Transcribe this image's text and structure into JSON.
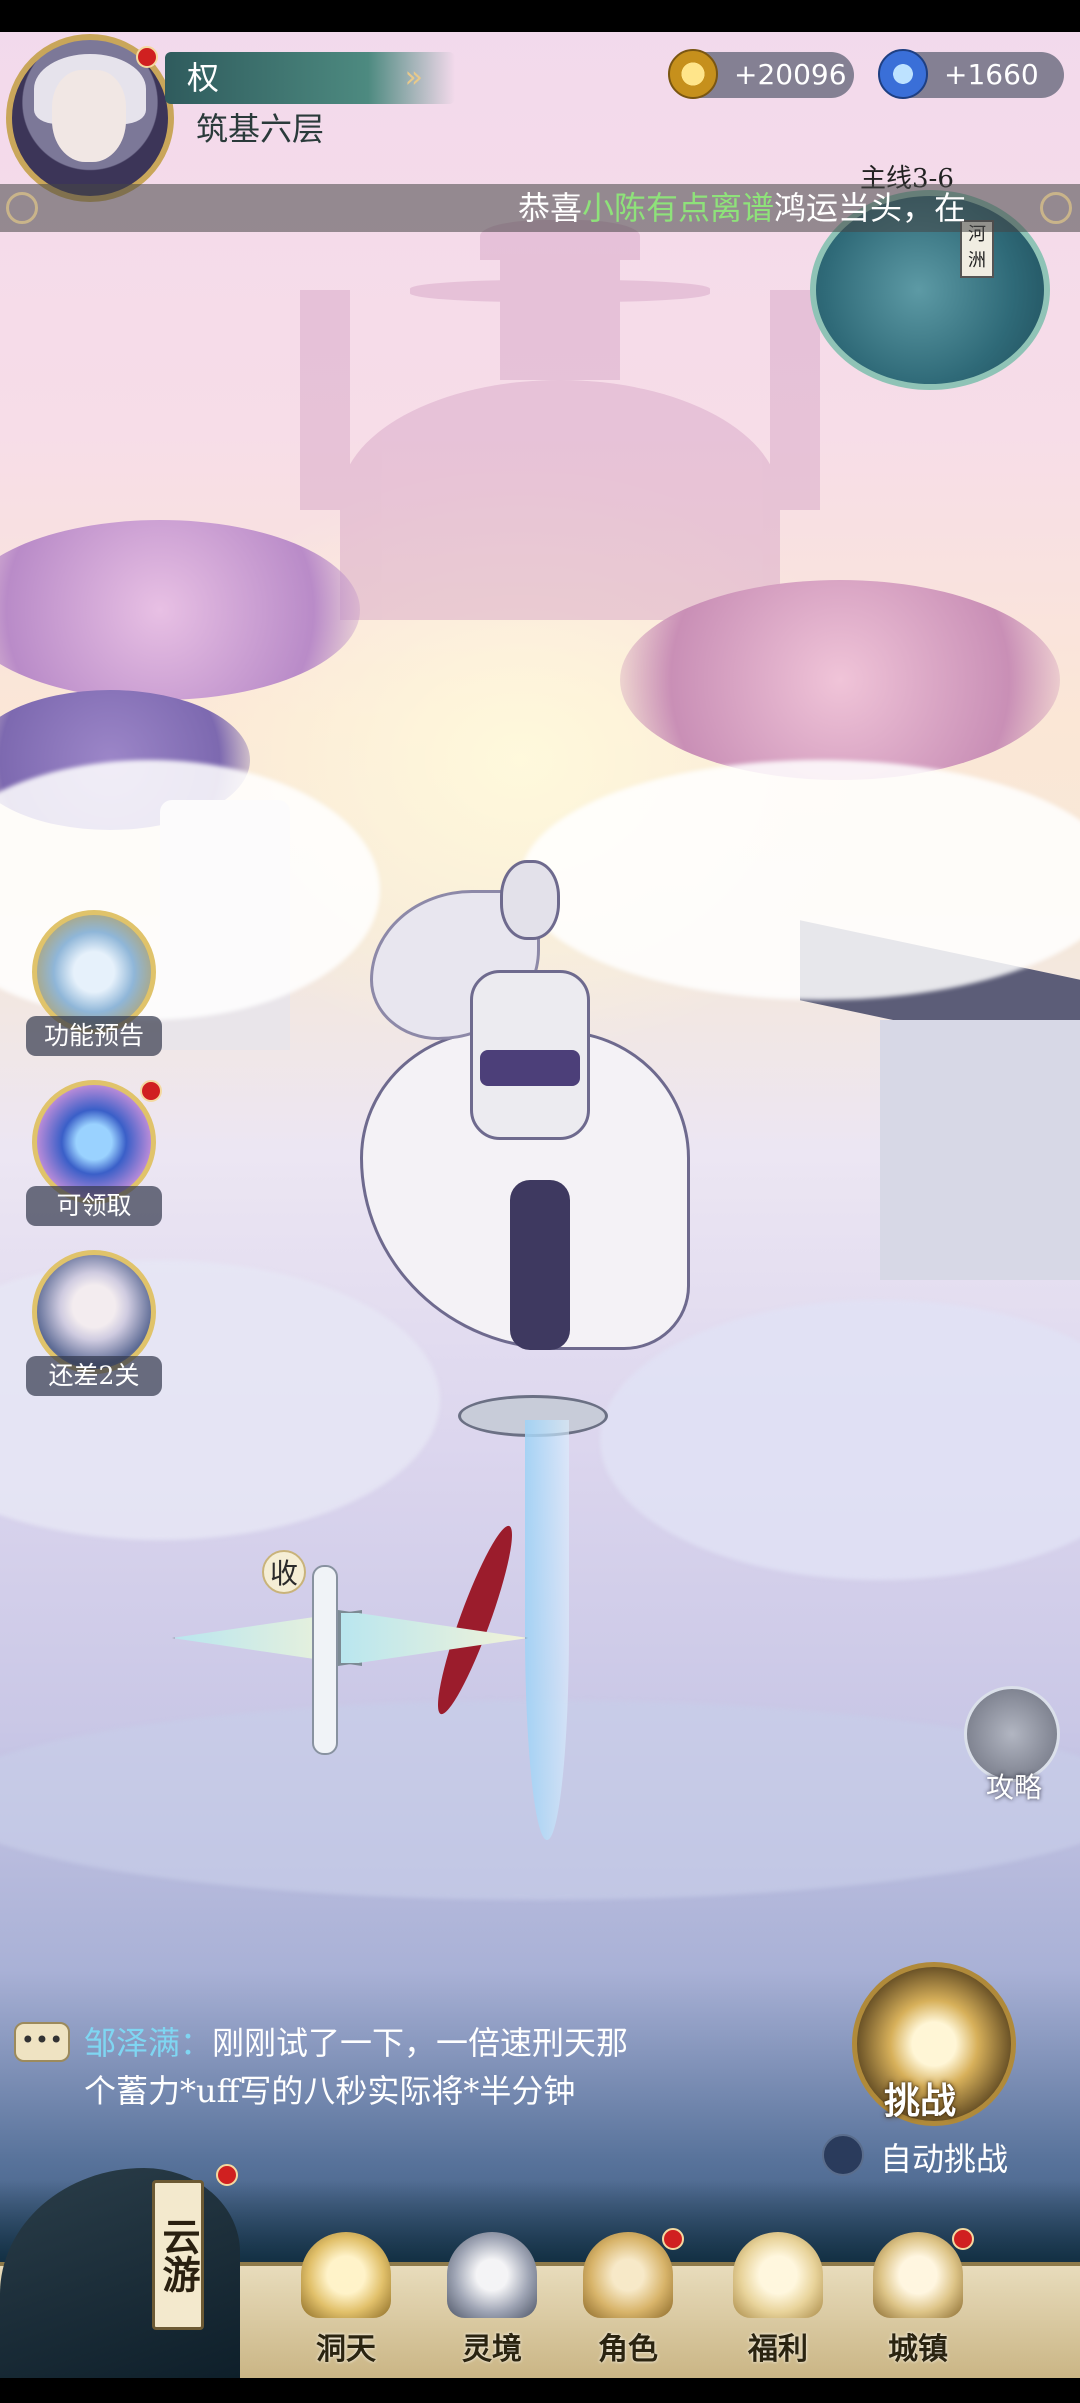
{
  "player": {
    "name": "权",
    "realm": "筑基六层"
  },
  "currency": {
    "coins": "20096",
    "gems": "1660"
  },
  "marquee": {
    "prefix": "恭喜",
    "player": "小陈有点离谱",
    "suffix": "鸿运当头，在"
  },
  "map": {
    "stage": "主线3-6",
    "location_tag": "河洲"
  },
  "scene": {
    "collect_label": "收"
  },
  "side_buttons": [
    {
      "label": "功能预告",
      "icon": "scroll-icon",
      "badge": false
    },
    {
      "label": "可领取",
      "icon": "crystal-icon",
      "badge": true
    },
    {
      "label": "还差2关",
      "icon": "character-portrait-icon",
      "badge": false
    }
  ],
  "strategy": {
    "label": "攻略",
    "icon": "scroll-guide-icon"
  },
  "chat": {
    "speaker": "邹泽满：",
    "line1": "刚刚试了一下，一倍速刑天那",
    "line2": "个蓄力*uff写的八秒实际将*半分钟"
  },
  "challenge": {
    "label": "挑战",
    "auto_label": "自动挑战"
  },
  "nav": {
    "yunyou": "云游",
    "items": [
      {
        "label": "洞天",
        "icon": "cave-icon",
        "badge": false
      },
      {
        "label": "灵境",
        "icon": "spirit-realm-icon",
        "badge": false
      },
      {
        "label": "角色",
        "icon": "character-icon",
        "badge": true
      },
      {
        "label": "福利",
        "icon": "welfare-bag-icon",
        "badge": false
      },
      {
        "label": "城镇",
        "icon": "town-icon",
        "badge": true
      }
    ]
  },
  "colors": {
    "marquee_highlight": "#8ee27a",
    "chat_speaker": "#7fd6f2",
    "badge": "#d02020"
  }
}
